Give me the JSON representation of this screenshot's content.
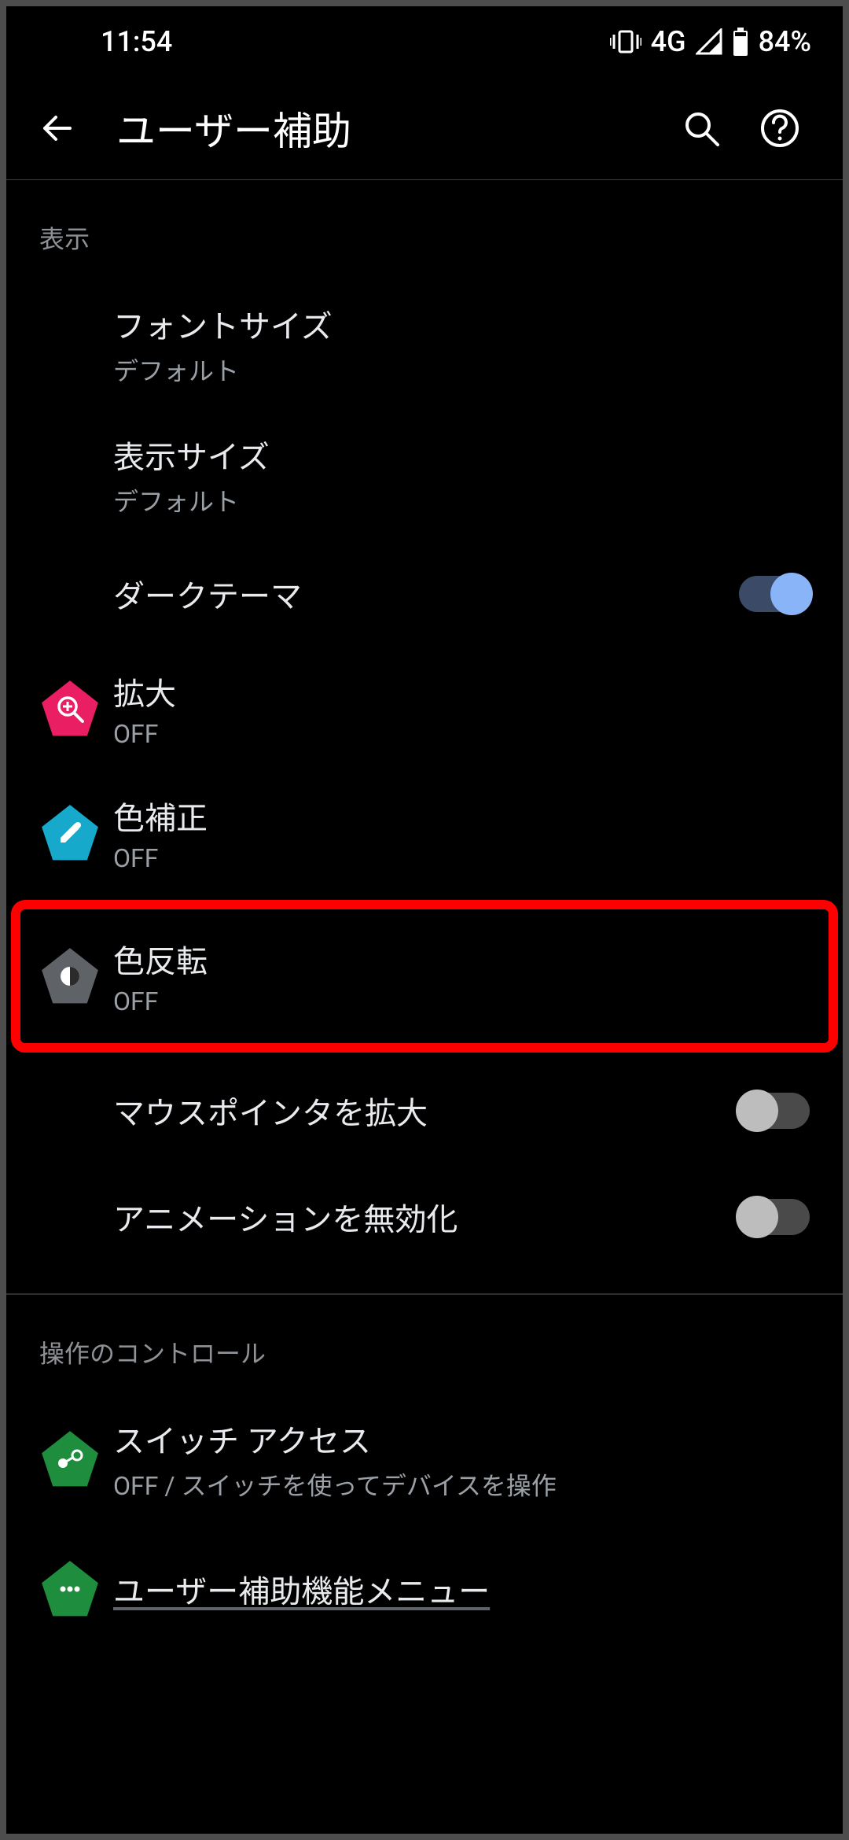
{
  "status": {
    "time": "11:54",
    "network": "4G",
    "battery": "84%"
  },
  "header": {
    "title": "ユーザー補助"
  },
  "sections": {
    "display": {
      "label": "表示",
      "font_size": {
        "title": "フォントサイズ",
        "sub": "デフォルト"
      },
      "display_size": {
        "title": "表示サイズ",
        "sub": "デフォルト"
      },
      "dark_theme": {
        "title": "ダークテーマ"
      },
      "magnification": {
        "title": "拡大",
        "sub": "OFF"
      },
      "color_correction": {
        "title": "色補正",
        "sub": "OFF"
      },
      "color_inversion": {
        "title": "色反転",
        "sub": "OFF"
      },
      "large_pointer": {
        "title": "マウスポインタを拡大"
      },
      "disable_animations": {
        "title": "アニメーションを無効化"
      }
    },
    "controls": {
      "label": "操作のコントロール",
      "switch_access": {
        "title": "スイッチ アクセス",
        "sub": "OFF / スイッチを使ってデバイスを操作"
      },
      "accessibility_menu": {
        "title": "ユーザー補助機能メニュー"
      }
    }
  }
}
